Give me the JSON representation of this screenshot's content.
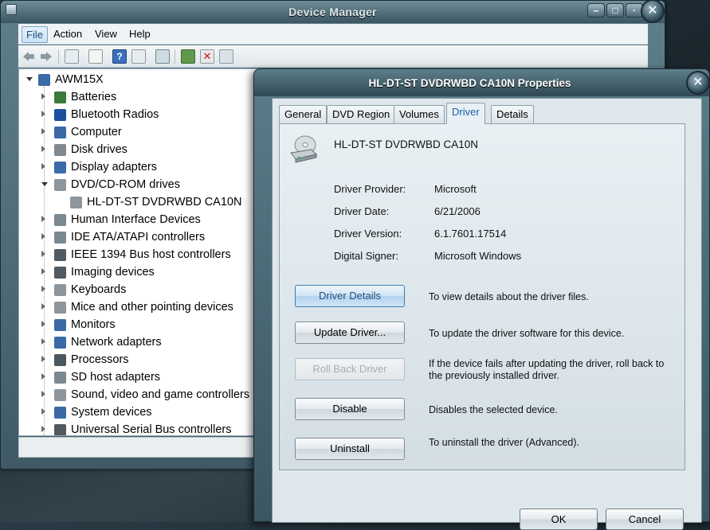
{
  "device_manager": {
    "title": "Device Manager",
    "menu": [
      "File",
      "Action",
      "View",
      "Help"
    ],
    "tree": {
      "root": "AWM15X",
      "items": [
        {
          "label": "Batteries",
          "icon": "battery-icon",
          "color": "#3a7a3a"
        },
        {
          "label": "Bluetooth Radios",
          "icon": "bluetooth-icon",
          "color": "#1c4fa0"
        },
        {
          "label": "Computer",
          "icon": "computer-icon",
          "color": "#3a6aa8"
        },
        {
          "label": "Disk drives",
          "icon": "disk-drive-icon",
          "color": "#808890"
        },
        {
          "label": "Display adapters",
          "icon": "display-adapter-icon",
          "color": "#3a6aa8"
        },
        {
          "label": "DVD/CD-ROM drives",
          "icon": "dvd-drive-icon",
          "color": "#8c969c"
        },
        {
          "label": "HL-DT-ST DVDRWBD CA10N",
          "icon": "dvd-drive-icon",
          "color": "#8c969c",
          "child": true
        },
        {
          "label": "Human Interface Devices",
          "icon": "hid-icon",
          "color": "#7a8890"
        },
        {
          "label": "IDE ATA/ATAPI controllers",
          "icon": "ide-controller-icon",
          "color": "#7a8890"
        },
        {
          "label": "IEEE 1394 Bus host controllers",
          "icon": "firewire-icon",
          "color": "#505a60"
        },
        {
          "label": "Imaging devices",
          "icon": "camera-icon",
          "color": "#505a60"
        },
        {
          "label": "Keyboards",
          "icon": "keyboard-icon",
          "color": "#8c969c"
        },
        {
          "label": "Mice and other pointing devices",
          "icon": "mouse-icon",
          "color": "#8c969c"
        },
        {
          "label": "Monitors",
          "icon": "monitor-icon",
          "color": "#3a6aa8"
        },
        {
          "label": "Network adapters",
          "icon": "network-adapter-icon",
          "color": "#3a6aa8"
        },
        {
          "label": "Processors",
          "icon": "processor-icon",
          "color": "#4c5860"
        },
        {
          "label": "SD host adapters",
          "icon": "sd-adapter-icon",
          "color": "#7a8890"
        },
        {
          "label": "Sound, video and game controllers",
          "icon": "speaker-icon",
          "color": "#8c969c"
        },
        {
          "label": "System devices",
          "icon": "system-device-icon",
          "color": "#3a6aa8"
        },
        {
          "label": "Universal Serial Bus controllers",
          "icon": "usb-icon",
          "color": "#505a60"
        }
      ]
    }
  },
  "properties": {
    "title": "HL-DT-ST DVDRWBD CA10N Properties",
    "tabs": [
      "General",
      "DVD Region",
      "Volumes",
      "Driver",
      "Details"
    ],
    "active_tab": "Driver",
    "device_name": "HL-DT-ST DVDRWBD CA10N",
    "fields": [
      {
        "label": "Driver Provider:",
        "value": "Microsoft"
      },
      {
        "label": "Driver Date:",
        "value": "6/21/2006"
      },
      {
        "label": "Driver Version:",
        "value": "6.1.7601.17514"
      },
      {
        "label": "Digital Signer:",
        "value": "Microsoft Windows"
      }
    ],
    "actions": [
      {
        "label": "Driver Details",
        "desc": "To view details about the driver files.",
        "state": "focused"
      },
      {
        "label": "Update Driver...",
        "desc": "To update the driver software for this device.",
        "state": "normal"
      },
      {
        "label": "Roll Back Driver",
        "desc": "If the device fails after updating the driver, roll back to the previously installed driver.",
        "state": "disabled"
      },
      {
        "label": "Disable",
        "desc": "Disables the selected device.",
        "state": "normal"
      },
      {
        "label": "Uninstall",
        "desc": "To uninstall the driver (Advanced).",
        "state": "normal"
      }
    ],
    "ok_label": "OK",
    "cancel_label": "Cancel"
  }
}
